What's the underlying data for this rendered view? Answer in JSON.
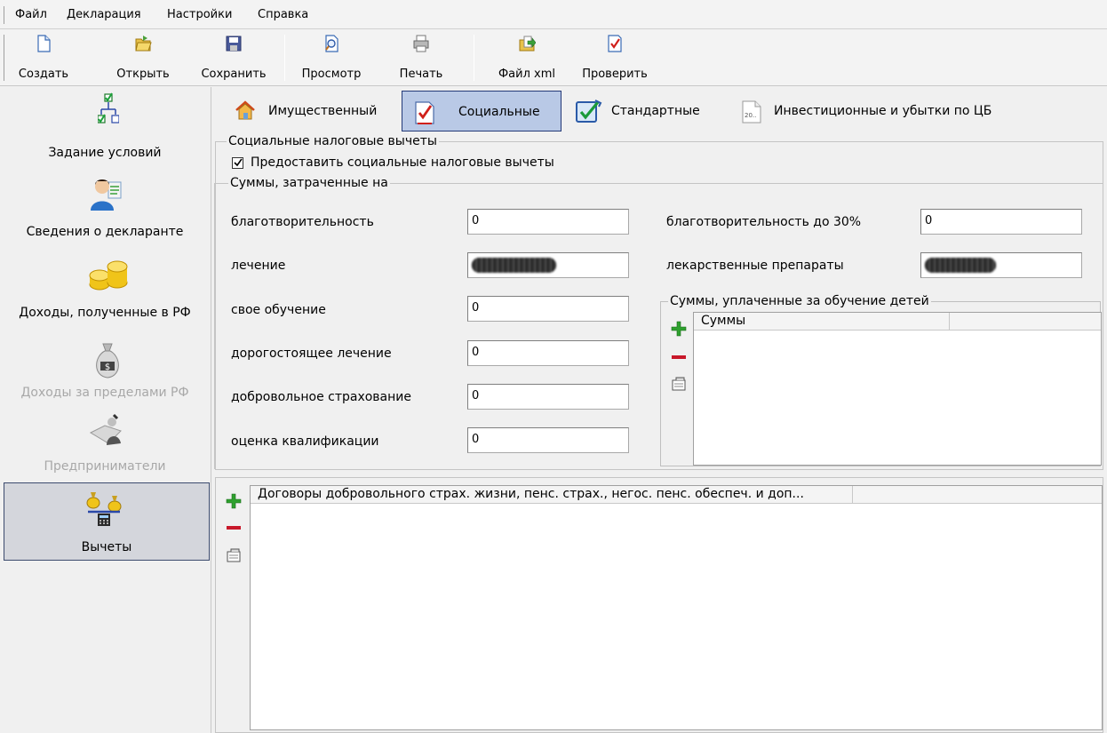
{
  "menu": [
    "Файл",
    "Декларация",
    "Настройки",
    "Справка"
  ],
  "toolbar": {
    "create": "Создать",
    "open": "Открыть",
    "save": "Сохранить",
    "preview": "Просмотр",
    "print": "Печать",
    "xml": "Файл xml",
    "check": "Проверить"
  },
  "nav": [
    {
      "label": "Задание условий",
      "icon": "conditions-tree-icon",
      "enabled": true
    },
    {
      "label": "Сведения о декларанте",
      "icon": "declarant-person-icon",
      "enabled": true
    },
    {
      "label": "Доходы, полученные в РФ",
      "icon": "coins-icon",
      "enabled": true
    },
    {
      "label": "Доходы за пределами РФ",
      "icon": "money-bag-icon",
      "enabled": false
    },
    {
      "label": "Предприниматели",
      "icon": "entrepreneur-icon",
      "enabled": false
    },
    {
      "label": "Вычеты",
      "icon": "deductions-scales-icon",
      "enabled": true,
      "active": true
    }
  ],
  "tabs": [
    {
      "label": "Имущественный",
      "icon": "house-icon"
    },
    {
      "label": "Социальные",
      "icon": "check-document-icon",
      "active": true
    },
    {
      "label": "Стандартные",
      "icon": "check-box-icon"
    },
    {
      "label": "Инвестиционные и убытки по ЦБ",
      "icon": "page-20-icon"
    }
  ],
  "social": {
    "group_title": "Социальные налоговые вычеты",
    "checkbox_label": "Предоставить социальные налоговые вычеты",
    "checkbox_checked": true,
    "sums_title": "Суммы, затраченные на",
    "fields": {
      "charity": {
        "label": "благотворительность",
        "value": "0"
      },
      "treatment": {
        "label": "лечение",
        "value": ""
      },
      "own_education": {
        "label": "свое обучение",
        "value": "0"
      },
      "expensive_treatment": {
        "label": "дорогостоящее лечение",
        "value": "0"
      },
      "voluntary_insurance": {
        "label": "добровольное страхование",
        "value": "0"
      },
      "qualification": {
        "label": "оценка квалификации",
        "value": "0"
      },
      "charity30": {
        "label": "благотворительность до 30%",
        "value": "0"
      },
      "medicines": {
        "label": "лекарственные препараты",
        "value": ""
      }
    },
    "children_title": "Суммы, уплаченные за обучение детей",
    "children_col": "Суммы",
    "contracts_col": "Договоры добровольного страх. жизни, пенс. страх., негос. пенс. обеспеч. и доп..."
  }
}
